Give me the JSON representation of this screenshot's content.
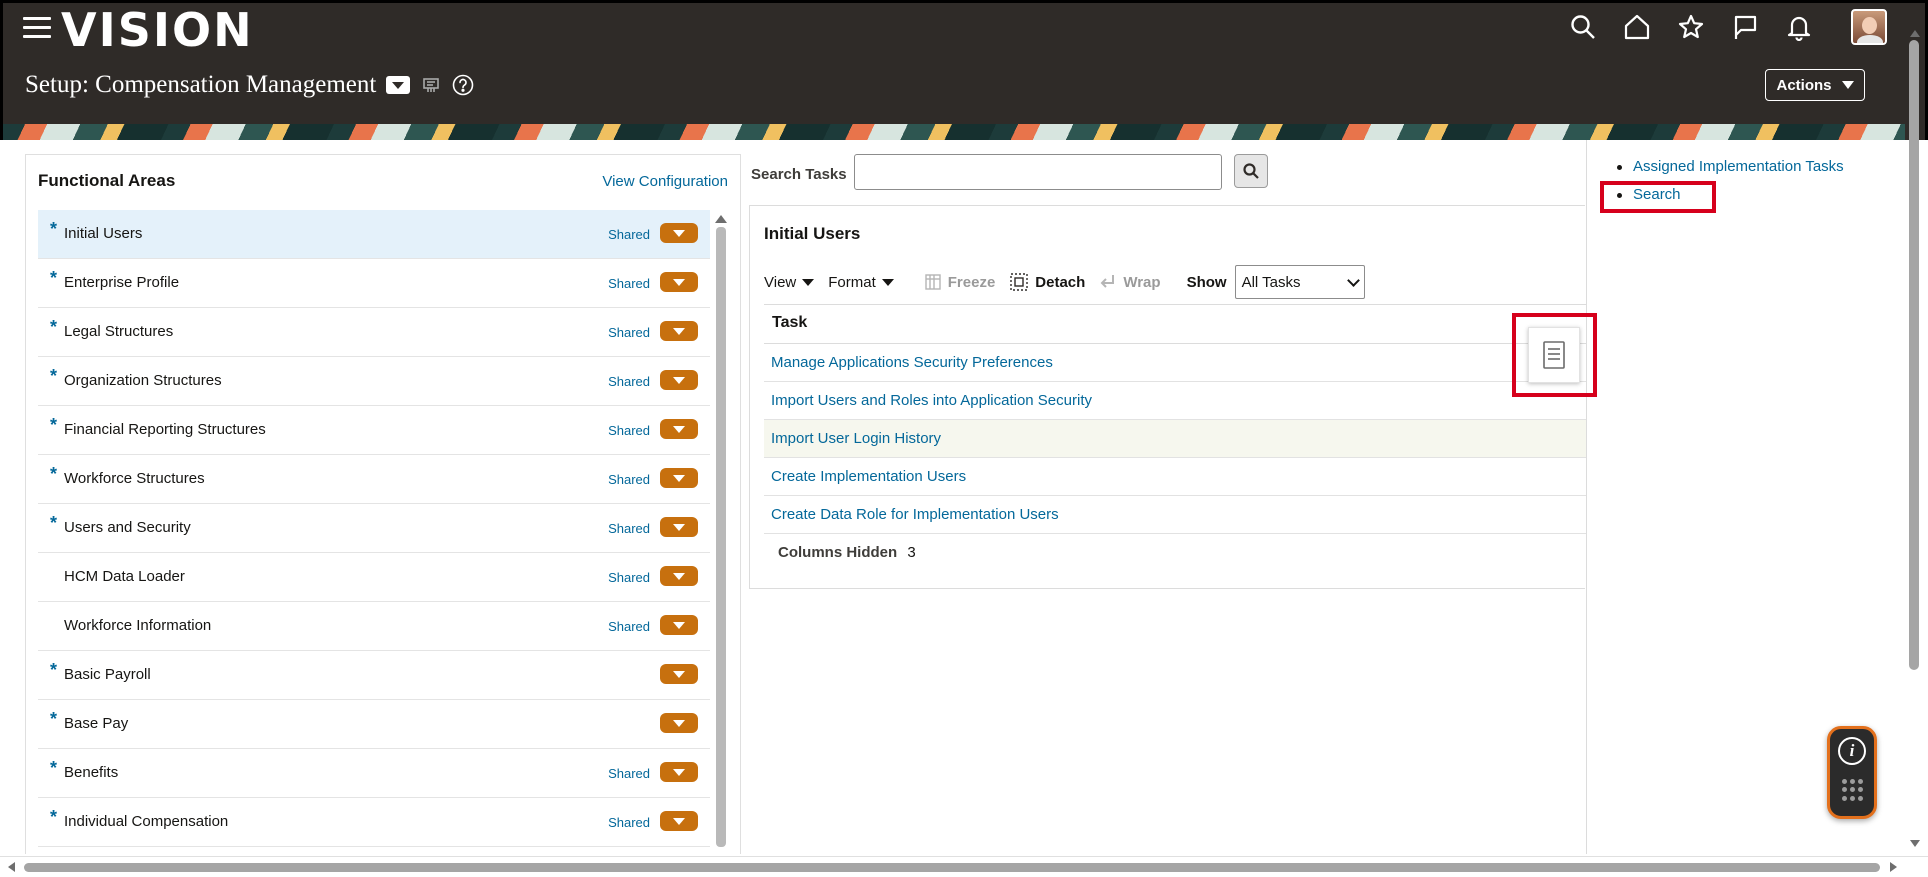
{
  "header": {
    "logo_text": "VISION",
    "page_title": "Setup: Compensation Management",
    "actions_label": "Actions",
    "icons": [
      "search-icon",
      "home-icon",
      "favorites-star-icon",
      "flag-icon",
      "notifications-bell-icon"
    ]
  },
  "functional_areas": {
    "title": "Functional Areas",
    "view_configuration": "View Configuration",
    "shared_label": "Shared",
    "items": [
      {
        "label": "Initial Users",
        "required": "*",
        "shared": "Shared"
      },
      {
        "label": "Enterprise Profile",
        "required": "*",
        "shared": "Shared"
      },
      {
        "label": "Legal Structures",
        "required": "*",
        "shared": "Shared"
      },
      {
        "label": "Organization Structures",
        "required": "*",
        "shared": "Shared"
      },
      {
        "label": "Financial Reporting Structures",
        "required": "*",
        "shared": "Shared"
      },
      {
        "label": "Workforce Structures",
        "required": "*",
        "shared": "Shared"
      },
      {
        "label": "Users and Security",
        "required": "*",
        "shared": "Shared"
      },
      {
        "label": "HCM Data Loader",
        "required": "",
        "shared": "Shared"
      },
      {
        "label": "Workforce Information",
        "required": "",
        "shared": "Shared"
      },
      {
        "label": "Basic Payroll",
        "required": "*",
        "shared": ""
      },
      {
        "label": "Base Pay",
        "required": "*",
        "shared": ""
      },
      {
        "label": "Benefits",
        "required": "*",
        "shared": "Shared"
      },
      {
        "label": "Individual Compensation",
        "required": "*",
        "shared": "Shared"
      }
    ]
  },
  "search_tasks": {
    "label": "Search Tasks",
    "value": "",
    "placeholder": ""
  },
  "task_panel": {
    "title": "Initial Users",
    "toolbar": {
      "view": "View",
      "format": "Format",
      "freeze": "Freeze",
      "detach": "Detach",
      "wrap": "Wrap",
      "show": "Show",
      "show_selected": "All Tasks"
    },
    "column_header": "Task",
    "tasks": [
      "Manage Applications Security Preferences",
      "Import Users and Roles into Application Security",
      "Import User Login History",
      "Create Implementation Users",
      "Create Data Role for Implementation Users"
    ],
    "columns_hidden_label": "Columns Hidden",
    "columns_hidden_count": "3"
  },
  "right_panel": {
    "links": [
      "Assigned Implementation Tasks",
      "Search"
    ]
  },
  "colors": {
    "header_bg": "#2f2b28",
    "link": "#04689a",
    "accent_orange": "#c7700e",
    "highlight_red": "#d6001c",
    "selected_row": "#e4f1fa"
  }
}
